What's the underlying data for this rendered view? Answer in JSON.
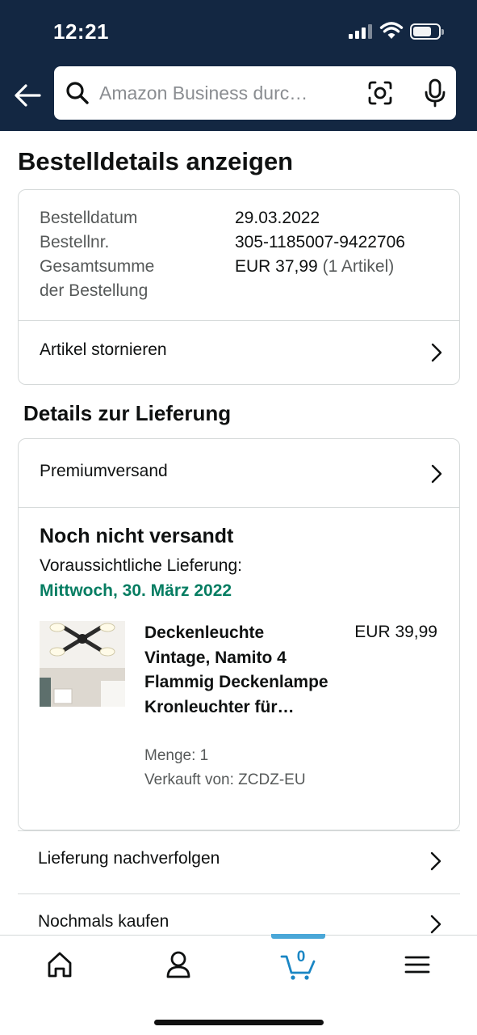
{
  "status_bar": {
    "time": "12:21"
  },
  "search": {
    "placeholder": "Amazon Business durc…"
  },
  "page_title": "Bestelldetails anzeigen",
  "order_summary": {
    "date_label": "Bestelldatum",
    "date_value": "29.03.2022",
    "number_label": "Bestellnr.",
    "number_value": "305-1185007-9422706",
    "total_label_line1": "Gesamtsumme",
    "total_label_line2": "der Bestellung",
    "total_value": "EUR 37,99",
    "total_items": "(1 Artikel)",
    "cancel_label": "Artikel stornieren"
  },
  "delivery": {
    "section_title": "Details zur Lieferung",
    "shipping_method": "Premiumversand",
    "status": "Noch nicht versandt",
    "estimate_label": "Voraussichtliche Lieferung:",
    "estimate_date": "Mittwoch, 30. März 2022",
    "estimate_color": "#067d62",
    "item": {
      "title": "Deckenleuchte Vintage, Namito 4 Flammig Deckenlampe Kronleuchter für…",
      "price": "EUR 39,99",
      "quantity": "Menge: 1",
      "seller": "Verkauft von: ZCDZ-EU"
    }
  },
  "actions": [
    {
      "label": "Lieferung nachverfolgen"
    },
    {
      "label": "Nochmals kaufen"
    }
  ],
  "tab_bar": {
    "cart_count": "0",
    "active_tab": "cart",
    "accent_color": "#4aa7d8",
    "icons": [
      "home-icon",
      "account-icon",
      "cart-icon",
      "menu-icon"
    ]
  },
  "colors": {
    "header_bg": "#132742"
  }
}
